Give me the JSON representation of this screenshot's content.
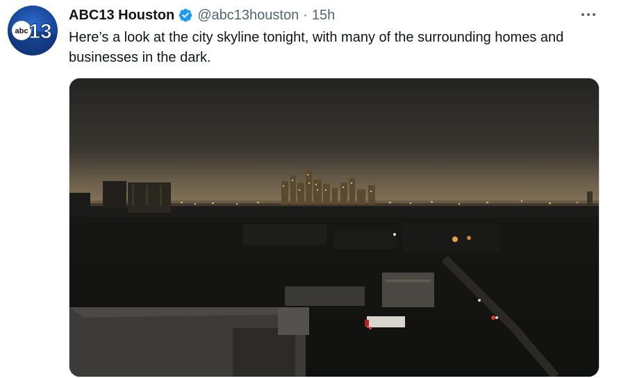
{
  "author": {
    "display_name": "ABC13 Houston",
    "handle": "@abc13houston",
    "separator": "·",
    "time": "15h",
    "avatar_logo_text": "abc 13"
  },
  "tweet": {
    "text": "Here’s a look at the city skyline tonight, with many of the surrounding homes and businesses in the dark."
  },
  "media": {
    "alt": "Night photo of Houston city skyline with surrounding neighborhood dark"
  },
  "icons": {
    "verified": "verified-badge-icon",
    "more": "more-options-icon"
  },
  "colors": {
    "verified_blue": "#1d9bf0",
    "text": "#0f1419",
    "secondary": "#536471",
    "avatar_blue": "#1a4fa8"
  }
}
